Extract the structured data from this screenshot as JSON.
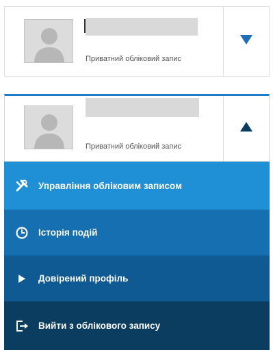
{
  "account_collapsed": {
    "subtitle": "Приватний обліковий запис",
    "toggle_icon": "chevron-down-icon",
    "accent_color": "#1e6fb6"
  },
  "account_expanded": {
    "subtitle": "Приватний обліковий запис",
    "toggle_icon": "chevron-up-icon",
    "accent_color": "#0a3d5f"
  },
  "menu": {
    "items": [
      {
        "label": "Управління обліковим записом",
        "icon": "tools-icon",
        "color": "#1f8fd6"
      },
      {
        "label": "Історія подій",
        "icon": "clock-icon",
        "color": "#166fb0"
      },
      {
        "label": "Довірений профіль",
        "icon": "play-icon",
        "color": "#0f5a92"
      },
      {
        "label": "Вийти з облікового запису",
        "icon": "logout-icon",
        "color": "#0a3d5f"
      }
    ]
  }
}
